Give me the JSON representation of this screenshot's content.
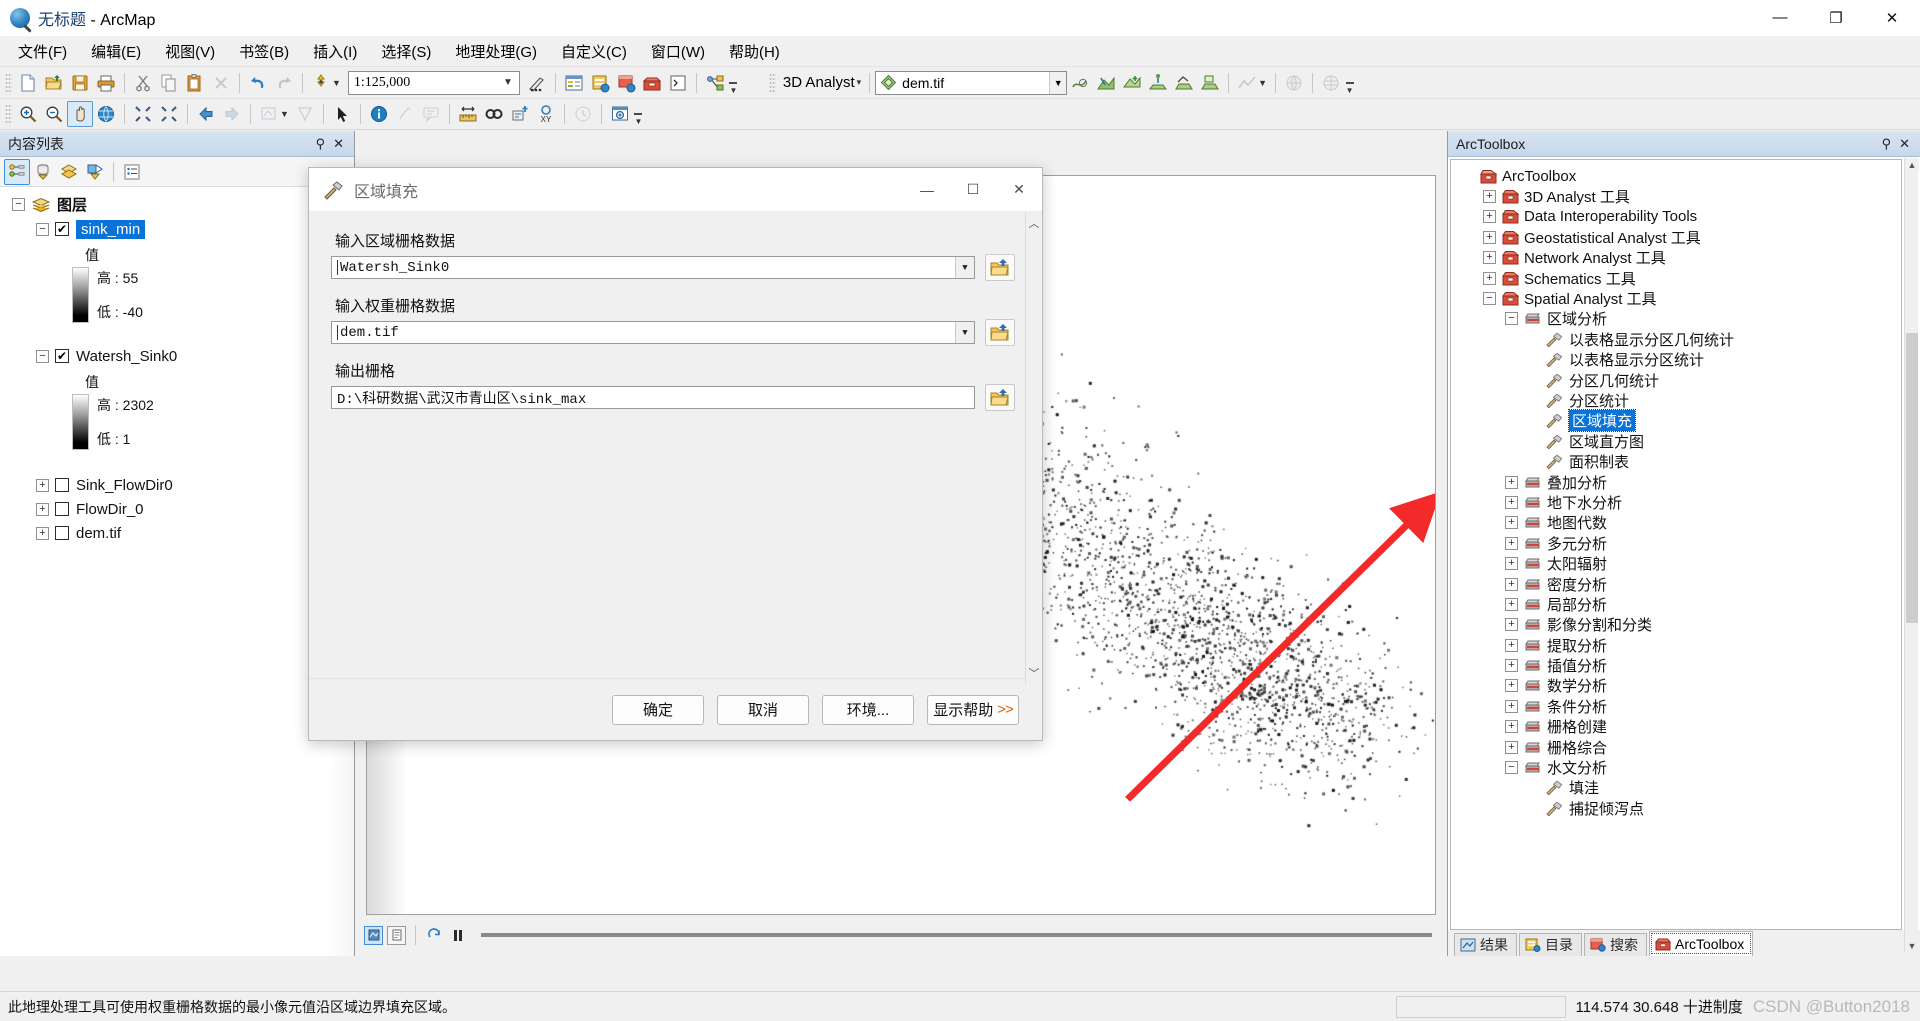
{
  "window": {
    "title_doc": "无标题",
    "title_app": " - ArcMap",
    "minimize": "—",
    "restore": "❐",
    "close": "✕"
  },
  "menu": {
    "items": [
      {
        "label": "文件(F)"
      },
      {
        "label": "编辑(E)"
      },
      {
        "label": "视图(V)"
      },
      {
        "label": "书签(B)"
      },
      {
        "label": "插入(I)"
      },
      {
        "label": "选择(S)"
      },
      {
        "label": "地理处理(G)"
      },
      {
        "label": "自定义(C)"
      },
      {
        "label": "窗口(W)"
      },
      {
        "label": "帮助(H)"
      }
    ]
  },
  "toolbar": {
    "scale_value": "1:125,000",
    "scale_arrow": "▼",
    "extension_label": "3D Analyst",
    "extension_caret": "▾",
    "layer_value": "dem.tif",
    "layer_arrow": "▼",
    "overflow": "▼"
  },
  "toc": {
    "header": "内容列表",
    "pin": "⚲",
    "close": "✕",
    "root": "图层",
    "layers": [
      {
        "name": "sink_min",
        "selected": true,
        "checked": true,
        "expander": "−",
        "legend_title": "值",
        "high": "高 : 55",
        "low": "低 : -40"
      },
      {
        "name": "Watersh_Sink0",
        "selected": false,
        "checked": true,
        "expander": "−",
        "legend_title": "值",
        "high": "高 : 2302",
        "low": "低 : 1"
      }
    ],
    "collapsed_layers": [
      {
        "name": "Sink_FlowDir0",
        "expander": "+",
        "checked": false
      },
      {
        "name": "FlowDir_0",
        "expander": "+",
        "checked": false
      },
      {
        "name": "dem.tif",
        "expander": "+",
        "checked": false
      }
    ]
  },
  "dialog": {
    "title": "区域填充",
    "minimize": "—",
    "maximize": "☐",
    "close": "✕",
    "scroll_up": "︿",
    "scroll_down": "﹀",
    "fields": [
      {
        "label": "输入区域栅格数据",
        "value": "Watersh_Sink0",
        "has_dropdown": true,
        "dropdown": "▼"
      },
      {
        "label": "输入权重栅格数据",
        "value": "dem.tif",
        "has_dropdown": true,
        "dropdown": "▼"
      },
      {
        "label": "输出栅格",
        "value": "D:\\科研数据\\武汉市青山区\\sink_max",
        "has_dropdown": false,
        "dropdown": ""
      }
    ],
    "buttons": [
      {
        "label": "确定",
        "suffix": ""
      },
      {
        "label": "取消",
        "suffix": ""
      },
      {
        "label": "环境...",
        "suffix": ""
      },
      {
        "label": "显示帮助",
        "suffix": ">>"
      }
    ]
  },
  "arctoolbox": {
    "header": "ArcToolbox",
    "pin": "⚲",
    "close": "✕",
    "tree": [
      {
        "label": "ArcToolbox",
        "depth": 0,
        "expander": "",
        "icon": "toolbox-open-icon",
        "selected": false
      },
      {
        "label": "3D Analyst 工具",
        "depth": 1,
        "expander": "+",
        "icon": "toolbox-icon",
        "selected": false
      },
      {
        "label": "Data Interoperability Tools",
        "depth": 1,
        "expander": "+",
        "icon": "toolbox-icon",
        "selected": false
      },
      {
        "label": "Geostatistical Analyst 工具",
        "depth": 1,
        "expander": "+",
        "icon": "toolbox-icon",
        "selected": false
      },
      {
        "label": "Network Analyst 工具",
        "depth": 1,
        "expander": "+",
        "icon": "toolbox-icon",
        "selected": false
      },
      {
        "label": "Schematics 工具",
        "depth": 1,
        "expander": "+",
        "icon": "toolbox-icon",
        "selected": false
      },
      {
        "label": "Spatial Analyst 工具",
        "depth": 1,
        "expander": "−",
        "icon": "toolbox-icon",
        "selected": false
      },
      {
        "label": "区域分析",
        "depth": 2,
        "expander": "−",
        "icon": "toolset-icon",
        "selected": false
      },
      {
        "label": "以表格显示分区几何统计",
        "depth": 3,
        "expander": "",
        "icon": "tool-icon",
        "selected": false
      },
      {
        "label": "以表格显示分区统计",
        "depth": 3,
        "expander": "",
        "icon": "tool-icon",
        "selected": false
      },
      {
        "label": "分区几何统计",
        "depth": 3,
        "expander": "",
        "icon": "tool-icon",
        "selected": false
      },
      {
        "label": "分区统计",
        "depth": 3,
        "expander": "",
        "icon": "tool-icon",
        "selected": false
      },
      {
        "label": "区域填充",
        "depth": 3,
        "expander": "",
        "icon": "tool-icon",
        "selected": true
      },
      {
        "label": "区域直方图",
        "depth": 3,
        "expander": "",
        "icon": "tool-icon",
        "selected": false
      },
      {
        "label": "面积制表",
        "depth": 3,
        "expander": "",
        "icon": "tool-icon",
        "selected": false
      },
      {
        "label": "叠加分析",
        "depth": 2,
        "expander": "+",
        "icon": "toolset-icon",
        "selected": false
      },
      {
        "label": "地下水分析",
        "depth": 2,
        "expander": "+",
        "icon": "toolset-icon",
        "selected": false
      },
      {
        "label": "地图代数",
        "depth": 2,
        "expander": "+",
        "icon": "toolset-icon",
        "selected": false
      },
      {
        "label": "多元分析",
        "depth": 2,
        "expander": "+",
        "icon": "toolset-icon",
        "selected": false
      },
      {
        "label": "太阳辐射",
        "depth": 2,
        "expander": "+",
        "icon": "toolset-icon",
        "selected": false
      },
      {
        "label": "密度分析",
        "depth": 2,
        "expander": "+",
        "icon": "toolset-icon",
        "selected": false
      },
      {
        "label": "局部分析",
        "depth": 2,
        "expander": "+",
        "icon": "toolset-icon",
        "selected": false
      },
      {
        "label": "影像分割和分类",
        "depth": 2,
        "expander": "+",
        "icon": "toolset-icon",
        "selected": false
      },
      {
        "label": "提取分析",
        "depth": 2,
        "expander": "+",
        "icon": "toolset-icon",
        "selected": false
      },
      {
        "label": "插值分析",
        "depth": 2,
        "expander": "+",
        "icon": "toolset-icon",
        "selected": false
      },
      {
        "label": "数学分析",
        "depth": 2,
        "expander": "+",
        "icon": "toolset-icon",
        "selected": false
      },
      {
        "label": "条件分析",
        "depth": 2,
        "expander": "+",
        "icon": "toolset-icon",
        "selected": false
      },
      {
        "label": "栅格创建",
        "depth": 2,
        "expander": "+",
        "icon": "toolset-icon",
        "selected": false
      },
      {
        "label": "栅格综合",
        "depth": 2,
        "expander": "+",
        "icon": "toolset-icon",
        "selected": false
      },
      {
        "label": "水文分析",
        "depth": 2,
        "expander": "−",
        "icon": "toolset-icon",
        "selected": false
      },
      {
        "label": "填洼",
        "depth": 3,
        "expander": "",
        "icon": "tool-icon",
        "selected": false
      },
      {
        "label": "捕捉倾泻点",
        "depth": 3,
        "expander": "",
        "icon": "tool-icon",
        "selected": false
      }
    ],
    "tabs": [
      {
        "label": "结果",
        "active": false,
        "icon": "results-icon"
      },
      {
        "label": "目录",
        "active": false,
        "icon": "catalog-icon"
      },
      {
        "label": "搜索",
        "active": false,
        "icon": "search-icon"
      },
      {
        "label": "ArcToolbox",
        "active": true,
        "icon": "toolbox-icon"
      }
    ]
  },
  "status": {
    "hint": "此地理处理工具可使用权重栅格数据的最小像元值沿区域边界填充区域。",
    "coordinates": "114.574  30.648 十进制度",
    "watermark": "CSDN @Button2018"
  },
  "colors": {
    "selection_blue": "#0a73d8",
    "arrow_red": "#f32a2a",
    "panel_header": "#c6d8ec",
    "chrome_gray": "#f0f0f0"
  }
}
